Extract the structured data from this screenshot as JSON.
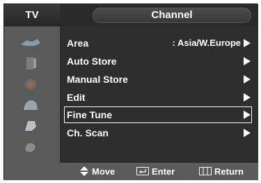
{
  "header": {
    "source_label": "TV",
    "menu_title": "Channel"
  },
  "sidebar": {
    "icons": [
      "picture-icon",
      "sound-icon",
      "channel-icon",
      "setup-icon",
      "input-icon",
      "application-icon"
    ]
  },
  "menu": {
    "items": [
      {
        "label": "Area",
        "value": ": Asia/W.Europe",
        "selected": false
      },
      {
        "label": "Auto Store",
        "value": "",
        "selected": false
      },
      {
        "label": "Manual Store",
        "value": "",
        "selected": false
      },
      {
        "label": "Edit",
        "value": "",
        "selected": false
      },
      {
        "label": "Fine Tune",
        "value": "",
        "selected": true
      },
      {
        "label": "Ch. Scan",
        "value": "",
        "selected": false
      }
    ]
  },
  "footer": {
    "move_label": "Move",
    "enter_label": "Enter",
    "return_label": "Return"
  },
  "colors": {
    "background": "#4a4a4a",
    "menu_background": "#2e2e2e",
    "text": "#ffffff"
  }
}
